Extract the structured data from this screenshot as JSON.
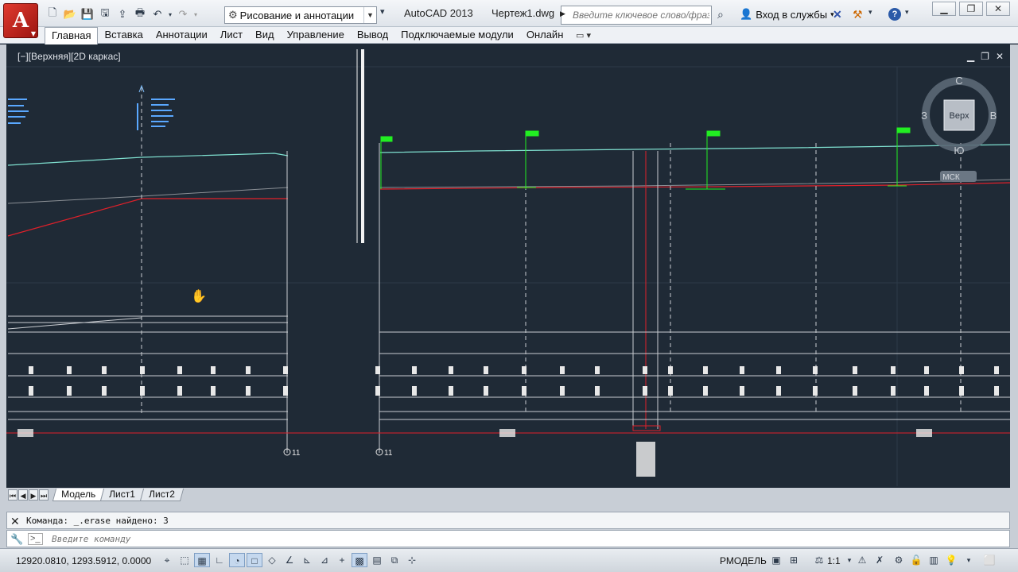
{
  "app": {
    "product": "AutoCAD 2013",
    "file": "Чертеж1.dwg",
    "logo_letter": "A"
  },
  "quick_access": {
    "workspace": "Рисование и аннотации"
  },
  "search": {
    "placeholder": "Введите ключевое слово/фразу"
  },
  "signin": {
    "label": "Вход в службы"
  },
  "ribbon": {
    "tabs": [
      "Главная",
      "Вставка",
      "Аннотации",
      "Лист",
      "Вид",
      "Управление",
      "Вывод",
      "Подключаемые модули",
      "Онлайн"
    ],
    "active_tab": "Главная"
  },
  "viewport": {
    "label": "[−][Верхняя][2D каркас]"
  },
  "viewcube": {
    "face": "Верх",
    "north": "С",
    "south": "Ю",
    "west": "З",
    "east": "В",
    "ucs": "МСК"
  },
  "drawing": {
    "station_markers": [
      "11",
      "11"
    ]
  },
  "layout_tabs": [
    "Модель",
    "Лист1",
    "Лист2"
  ],
  "active_layout": "Модель",
  "command": {
    "history": "Команда: _.erase найдено: 3",
    "placeholder": "Введите команду"
  },
  "status": {
    "coordinates": "12920.0810, 1293.5912, 0.0000",
    "space": "РМОДЕЛЬ",
    "annotation_scale": "1:1"
  },
  "colors": {
    "canvas": "#1f2a36",
    "profile_ground": "#7fe0d0",
    "profile_design": "#e0202a",
    "markers": "#22ee22"
  }
}
